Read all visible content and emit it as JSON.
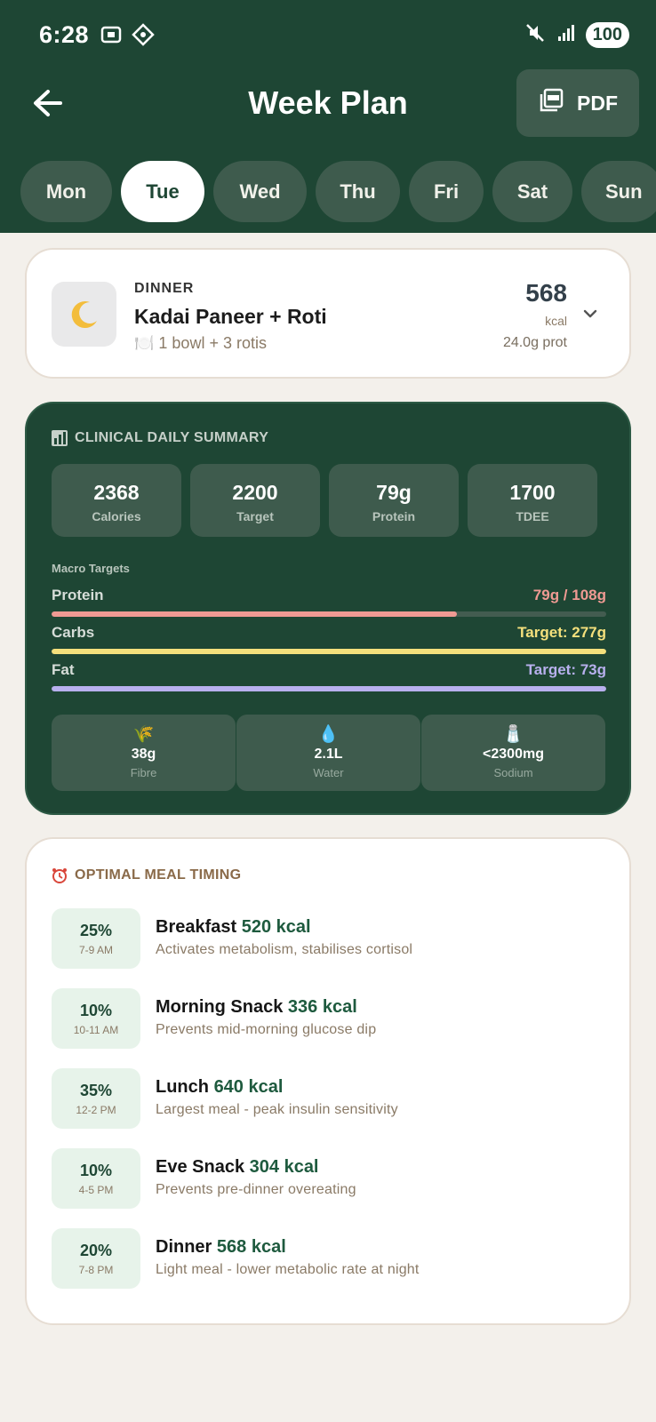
{
  "status": {
    "time": "6:28",
    "battery": "100"
  },
  "header": {
    "title": "Week Plan",
    "pdf_label": "PDF"
  },
  "days": [
    "Mon",
    "Tue",
    "Wed",
    "Thu",
    "Fri",
    "Sat",
    "Sun"
  ],
  "active_day": "Tue",
  "meal": {
    "kind": "DINNER",
    "name": "Kadai Paneer + Roti",
    "portion": "🍽️ 1 bowl + 3 rotis",
    "kcal": "568",
    "kcal_unit": "kcal",
    "protein": "24.0g prot",
    "icon": "moon-icon"
  },
  "summary": {
    "title": "CLINICAL DAILY SUMMARY",
    "icon": "bar-chart-icon",
    "stats": [
      {
        "value": "2368",
        "label": "Calories"
      },
      {
        "value": "2200",
        "label": "Target"
      },
      {
        "value": "79g",
        "label": "Protein"
      },
      {
        "value": "1700",
        "label": "TDEE"
      }
    ],
    "macro_heading": "Macro Targets",
    "macros": [
      {
        "name": "Protein",
        "value": "79g / 108g",
        "fill": 0.73,
        "color": "#ef9a93"
      },
      {
        "name": "Carbs",
        "value": "Target: 277g",
        "fill": 1.0,
        "color": "#f4e07c"
      },
      {
        "name": "Fat",
        "value": "Target: 73g",
        "fill": 1.0,
        "color": "#b8b0ee"
      }
    ],
    "extras": [
      {
        "icon": "🌾",
        "value": "38g",
        "label": "Fibre"
      },
      {
        "icon": "💧",
        "value": "2.1L",
        "label": "Water"
      },
      {
        "icon": "🧂",
        "value": "<2300mg",
        "label": "Sodium"
      }
    ]
  },
  "timing": {
    "title": "OPTIMAL MEAL TIMING",
    "icon": "alarm-clock-icon",
    "rows": [
      {
        "pct": "25%",
        "time": "7-9 AM",
        "name": "Breakfast",
        "kcal": "520 kcal",
        "desc": "Activates metabolism, stabilises cortisol"
      },
      {
        "pct": "10%",
        "time": "10-11 AM",
        "name": "Morning Snack",
        "kcal": "336 kcal",
        "desc": "Prevents mid-morning glucose dip"
      },
      {
        "pct": "35%",
        "time": "12-2 PM",
        "name": "Lunch",
        "kcal": "640 kcal",
        "desc": "Largest meal - peak insulin sensitivity"
      },
      {
        "pct": "10%",
        "time": "4-5 PM",
        "name": "Eve Snack",
        "kcal": "304 kcal",
        "desc": "Prevents pre-dinner overeating"
      },
      {
        "pct": "20%",
        "time": "7-8 PM",
        "name": "Dinner",
        "kcal": "568 kcal",
        "desc": "Light meal - lower metabolic rate at night"
      }
    ]
  }
}
